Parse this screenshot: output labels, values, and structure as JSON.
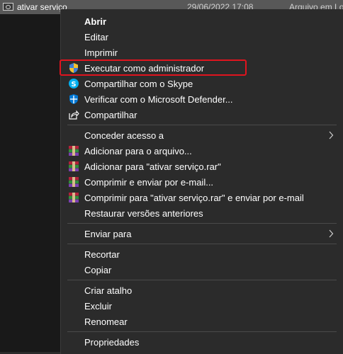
{
  "background_row": {
    "file_name": "ativar serviço",
    "date": "29/06/2022 17:08",
    "type": "Arquivo em Lo"
  },
  "menu": {
    "open": "Abrir",
    "edit": "Editar",
    "print": "Imprimir",
    "run_as_admin": "Executar como administrador",
    "share_skype": "Compartilhar com o Skype",
    "defender": "Verificar com o Microsoft Defender...",
    "share": "Compartilhar",
    "grant_access": "Conceder acesso a",
    "add_archive": "Adicionar para o arquivo...",
    "add_rar": "Adicionar para \"ativar serviço.rar\"",
    "compress_email": "Comprimir e enviar por e-mail...",
    "compress_rar_email": "Comprimir para \"ativar serviço.rar\" e enviar por e-mail",
    "restore_versions": "Restaurar versões anteriores",
    "send_to": "Enviar para",
    "cut": "Recortar",
    "copy": "Copiar",
    "create_shortcut": "Criar atalho",
    "delete": "Excluir",
    "rename": "Renomear",
    "properties": "Propriedades"
  },
  "icons": {
    "uac_shield": "uac-shield-icon",
    "skype": "skype-icon",
    "defender": "defender-shield-icon",
    "share": "share-icon",
    "winrar": "winrar-icon",
    "submenu": "chevron-right-icon"
  },
  "colors": {
    "menu_bg": "#2b2b2b",
    "highlight_border": "#e0141e",
    "skype_blue": "#00aff0",
    "defender_blue": "#0078d4"
  }
}
